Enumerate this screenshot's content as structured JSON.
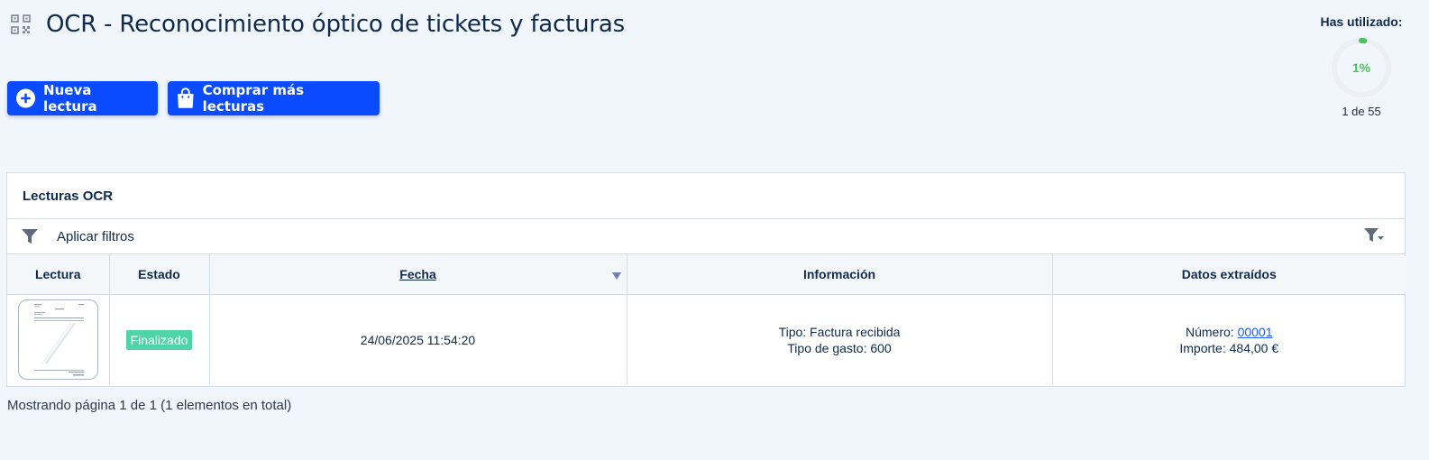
{
  "header": {
    "title": "OCR - Reconocimiento óptico de tickets y facturas",
    "icon": "qr-scan-icon"
  },
  "actions": {
    "new_label": "Nueva lectura",
    "buy_label": "Comprar más lecturas"
  },
  "usage": {
    "label": "Has utilizado:",
    "percent_text": "1%",
    "percent_value": 0.018,
    "count_text": "1 de 55"
  },
  "panel": {
    "title": "Lecturas OCR",
    "filter_label": "Aplicar filtros"
  },
  "table": {
    "columns": [
      "Lectura",
      "Estado",
      "Fecha",
      "Información",
      "Datos extraídos"
    ],
    "rows": [
      {
        "estado": "Finalizado",
        "fecha": "24/06/2025 11:54:20",
        "info_tipo": "Tipo: Factura recibida",
        "info_gasto": "Tipo de gasto: 600",
        "numero_label": "Número: ",
        "numero_value": "00001",
        "importe": "Importe: 484,00 €"
      }
    ]
  },
  "footer": {
    "pager": "Mostrando página 1 de 1 (1 elementos en total)"
  },
  "colors": {
    "primary": "#0a4bff",
    "success": "#4dd4a7",
    "gauge": "#4cc35d",
    "background": "#f1f6fd"
  }
}
